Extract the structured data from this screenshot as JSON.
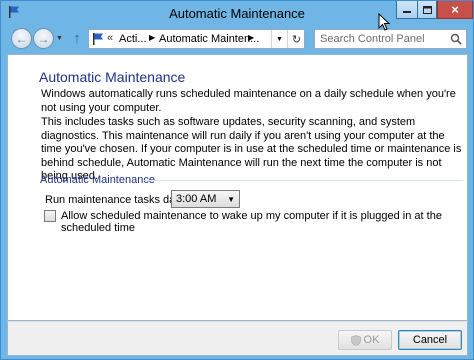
{
  "window": {
    "title": "Automatic Maintenance",
    "controls": {
      "minimize": "minimize",
      "maximize": "maximize",
      "close": "×"
    }
  },
  "navbar": {
    "breadcrumbs": [
      "Acti...",
      "Automatic Mainten..."
    ],
    "overflow": "«",
    "search_placeholder": "Search Control Panel"
  },
  "content": {
    "heading": "Automatic Maintenance",
    "description": "Windows automatically runs scheduled maintenance on a daily schedule when you're not using your computer.",
    "details": "This includes tasks such as software updates, security scanning, and system diagnostics. This maintenance will run daily if you aren't using your computer at the time you've chosen. If your computer is in use at the scheduled time or maintenance is behind schedule, Automatic Maintenance will run the next time the computer is not being used.",
    "section_label": "Automatic Maintenance",
    "run_label": "Run maintenance tasks daily at",
    "run_time": "3:00 AM",
    "wake_checkbox_label": "Allow scheduled maintenance to wake up my computer if it is plugged in at the scheduled time",
    "wake_checked": false
  },
  "footer": {
    "ok_label": "OK",
    "cancel_label": "Cancel"
  },
  "colors": {
    "frame": "#6fb6e6",
    "heading": "#1e3287",
    "close_button": "#c7504a"
  }
}
